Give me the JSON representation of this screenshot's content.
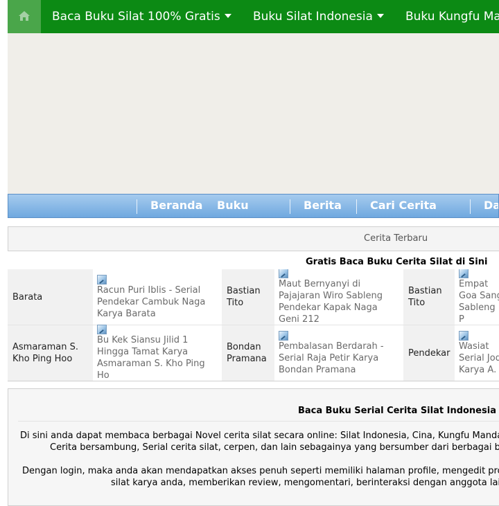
{
  "topnav": {
    "home_icon": "home-icon",
    "items": [
      {
        "label": "Baca Buku Silat 100% Gratis",
        "has_dropdown": true
      },
      {
        "label": "Buku Silat Indonesia",
        "has_dropdown": true
      },
      {
        "label": "Buku Kungfu Ma",
        "has_dropdown": false
      }
    ],
    "bg_color": "#0c8a14",
    "home_bg_color": "#4aa64a"
  },
  "bluemenu": {
    "items": [
      "Beranda",
      "Buku",
      "Berita",
      "Cari Cerita",
      "Da"
    ]
  },
  "terbaru": {
    "label": "Cerita Terbaru"
  },
  "gratis_heading": "Gratis Baca Buku Cerita Silat di Sini",
  "table": {
    "rows": [
      [
        {
          "author": "Barata",
          "title": "Racun Puri Iblis - Serial Pendekar Cambuk Naga Karya Barata"
        },
        {
          "author": "Bastian Tito",
          "title": "Maut Bernyanyi di Pajajaran Wiro Sableng Pendekar Kapak Naga Geni 212"
        },
        {
          "author": "Bastian Tito",
          "title": "Empat Goa Sang Sableng P"
        }
      ],
      [
        {
          "author": "Asmaraman S. Kho Ping Hoo",
          "title": "Bu Kek Siansu Jilid 1 Hingga Tamat Karya Asmaraman S. Kho Ping Ho"
        },
        {
          "author": "Bondan Pramana",
          "title": "Pembalasan Berdarah - Serial Raja Petir Karya Bondan Pramana"
        },
        {
          "author": "Pendekar",
          "title": "Wasiat Serial Jod Karya A."
        }
      ]
    ]
  },
  "info": {
    "title": "Baca Buku Serial Cerita Silat Indonesia",
    "p1_line1": "Di sini anda dapat membaca berbagai Novel cerita silat secara online: Silat Indonesia, Cina, Kungfu Manda",
    "p1_line2": "Cerita bersambung, Serial cerita silat, cerpen, dan lain sebagainya yang bersumber dari berbagai b",
    "p2_line1": "Dengan login, maka anda akan mendapatkan akses penuh seperti memiliki halaman profile, mengedit pro",
    "p2_line2": "silat karya anda, memberikan review, mengomentari, berinteraksi dengan anggota lai"
  }
}
